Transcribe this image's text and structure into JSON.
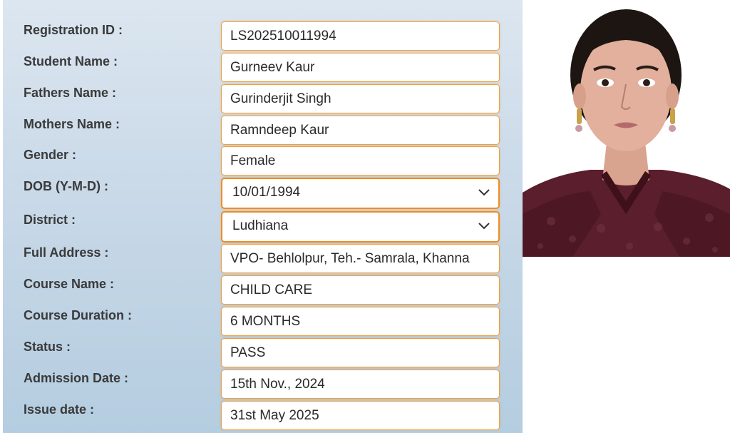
{
  "fields": [
    {
      "label": "Registration ID :",
      "value": "LS202510011994"
    },
    {
      "label": "Student Name :",
      "value": "Gurneev Kaur"
    },
    {
      "label": "Fathers Name :",
      "value": "Gurinderjit Singh"
    },
    {
      "label": "Mothers Name :",
      "value": "Ramndeep Kaur"
    },
    {
      "label": "Gender :",
      "value": "Female"
    },
    {
      "label": "DOB (Y-M-D) :",
      "value": "10/01/1994"
    },
    {
      "label": "District :",
      "value": "Ludhiana"
    },
    {
      "label": "Full Address :",
      "value": "VPO- Behlolpur, Teh.- Samrala, Khanna"
    },
    {
      "label": "Course Name :",
      "value": "CHILD CARE"
    },
    {
      "label": "Course Duration :",
      "value": "6 MONTHS"
    },
    {
      "label": "Status :",
      "value": "PASS"
    },
    {
      "label": "Admission Date :",
      "value": "15th Nov., 2024"
    },
    {
      "label": "Issue date :",
      "value": "31st May 2025"
    }
  ],
  "colors": {
    "field_border": "#f0a040",
    "select_border": "#f08c1e",
    "label_text": "#3a3a3a",
    "panel_top": "#dce6f0",
    "panel_bottom": "#b4cde0"
  },
  "icons": {
    "dropdown": "chevron-down-icon",
    "photo": "student-photo"
  }
}
